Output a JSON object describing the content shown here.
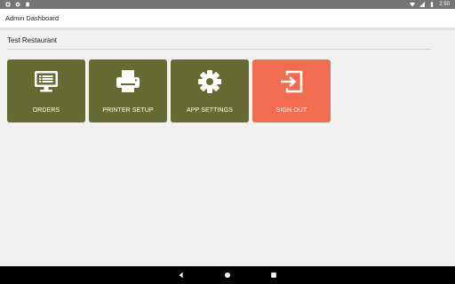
{
  "status_bar": {
    "time": "2:50",
    "icons_left": [
      "notification-icon",
      "settings-icon",
      "sd-card-icon"
    ],
    "icons_right": [
      "wifi-icon",
      "signal-icon",
      "battery-icon"
    ]
  },
  "app_bar": {
    "title": "Admin Dashboard"
  },
  "main": {
    "restaurant_name": "Test Restaurant",
    "tiles": [
      {
        "label": "ORDERS",
        "icon": "desktop-list-icon",
        "color": "#666a33"
      },
      {
        "label": "PRINTER SETUP",
        "icon": "printer-icon",
        "color": "#666a33"
      },
      {
        "label": "APP SETTINGS",
        "icon": "gear-icon",
        "color": "#666a33"
      },
      {
        "label": "SIGN OUT",
        "icon": "sign-out-icon",
        "color": "#f26d4f"
      }
    ]
  },
  "nav_bar": {
    "buttons": [
      "back-icon",
      "home-icon",
      "recents-icon"
    ]
  },
  "colors": {
    "status_bar": "#757575",
    "background": "#f1f1f1",
    "tile_primary": "#666a33",
    "tile_signout": "#f26d4f"
  }
}
